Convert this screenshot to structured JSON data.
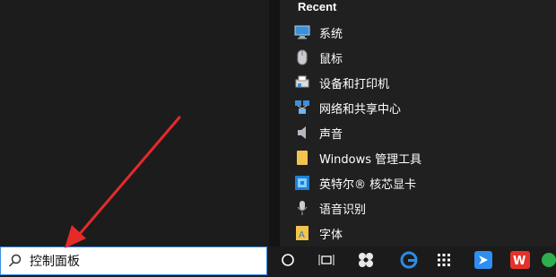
{
  "start_menu": {
    "section_title": "Recent",
    "items": [
      {
        "label": "系统",
        "icon": "system-icon"
      },
      {
        "label": "鼠标",
        "icon": "mouse-icon"
      },
      {
        "label": "设备和打印机",
        "icon": "devices-printers-icon"
      },
      {
        "label": "网络和共享中心",
        "icon": "network-sharing-icon"
      },
      {
        "label": "声音",
        "icon": "sound-icon"
      },
      {
        "label": "Windows 管理工具",
        "icon": "folder-icon"
      },
      {
        "label": "英特尔® 核芯显卡",
        "icon": "intel-graphics-icon"
      },
      {
        "label": "语音识别",
        "icon": "microphone-icon"
      },
      {
        "label": "字体",
        "icon": "fonts-icon"
      }
    ]
  },
  "search": {
    "value": "控制面板"
  },
  "taskbar": {
    "icons": [
      "cortana-icon",
      "task-view-icon",
      "app-icon",
      "edge-icon",
      "apps-grid-icon",
      "feishu-icon",
      "wps-icon",
      "browser-icon"
    ]
  },
  "colors": {
    "accent": "#3a8ee6",
    "arrow": "#e52a2a"
  }
}
